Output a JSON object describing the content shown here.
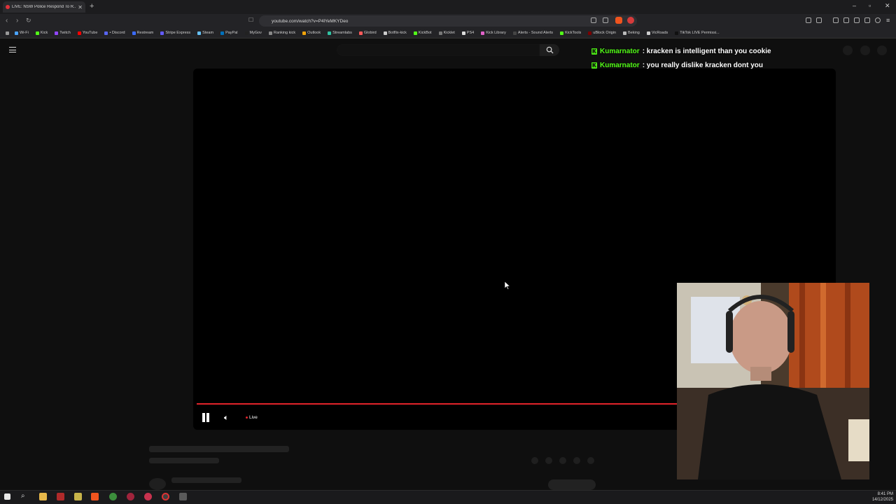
{
  "browser": {
    "tab_title": "LIVE: NSW Police Respond To R...",
    "tab_close": "✕",
    "new_tab": "+",
    "url": "youtube.com/watch?v=P4lYeMKYDeo",
    "window_controls": [
      "–",
      "▫",
      "✕"
    ]
  },
  "bookmarks": [
    {
      "label": "Wi-Fi",
      "color": "#4aa3ff"
    },
    {
      "label": "Kick",
      "color": "#53fc18"
    },
    {
      "label": "Twitch",
      "color": "#9146ff"
    },
    {
      "label": "YouTube",
      "color": "#ff0000"
    },
    {
      "label": "• Discord",
      "color": "#5865f2"
    },
    {
      "label": "Restream",
      "color": "#3b6cff"
    },
    {
      "label": "Stripe Express",
      "color": "#635bff"
    },
    {
      "label": "Steam",
      "color": "#66c0f4"
    },
    {
      "label": "PayPal",
      "color": "#0070ba"
    },
    {
      "label": "MyGov",
      "color": "#222222"
    },
    {
      "label": "Ranking kick",
      "color": "#888888"
    },
    {
      "label": "Outlook",
      "color": "#f0a30a"
    },
    {
      "label": "Streamlabs",
      "color": "#31c3a2"
    },
    {
      "label": "Globird",
      "color": "#ff5a5a"
    },
    {
      "label": "Botflix-kick",
      "color": "#cccccc"
    },
    {
      "label": "KickBot",
      "color": "#53fc18"
    },
    {
      "label": "Kicklet",
      "color": "#777777"
    },
    {
      "label": "PS4",
      "color": "#dddddd"
    },
    {
      "label": "Kick Library",
      "color": "#e062c8"
    },
    {
      "label": "Alerts - Sound Alerts",
      "color": "#444444"
    },
    {
      "label": "KickTools",
      "color": "#53fc18"
    },
    {
      "label": "uBlock Origin",
      "color": "#7a0000"
    },
    {
      "label": "Beking",
      "color": "#bbbbbb"
    },
    {
      "label": "VicRoads",
      "color": "#cccccc"
    },
    {
      "label": "TikTok LIVE Permissi...",
      "color": "#111111"
    }
  ],
  "player": {
    "live_label": "Live"
  },
  "chat": [
    {
      "user": "Kumarnator",
      "message": ": kracken is intelligent than you cookie"
    },
    {
      "user": "Kumarnator",
      "message": ": you really dislike kracken dont you"
    }
  ],
  "taskbar": {
    "time": "8:41 PM",
    "date": "14/12/2025"
  },
  "colors": {
    "accent": "#e2232a",
    "kick_green": "#53fc18"
  }
}
